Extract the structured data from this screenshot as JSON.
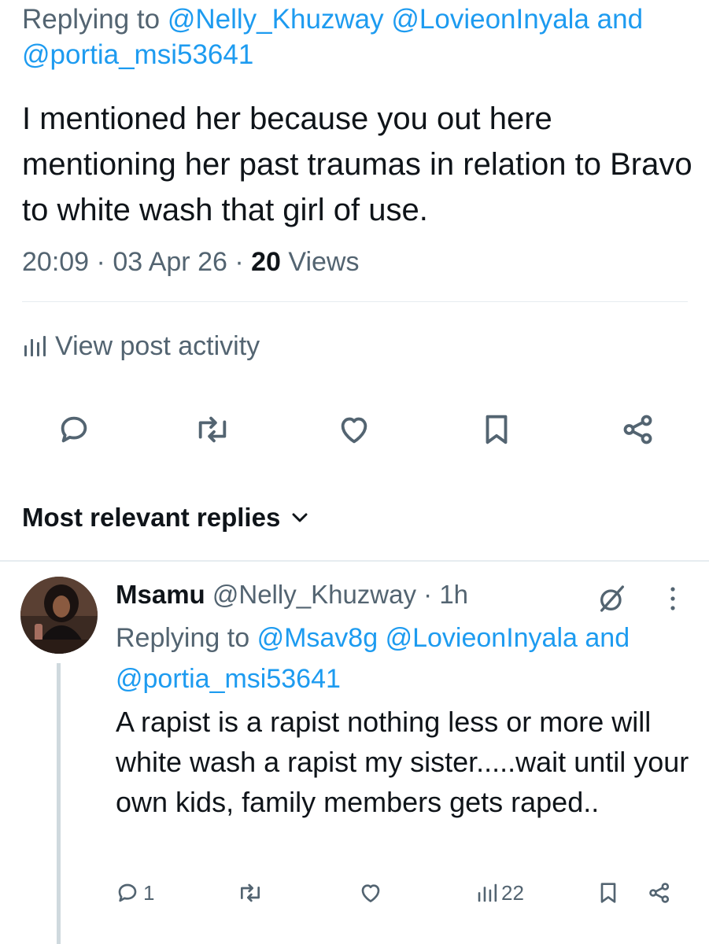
{
  "post": {
    "replying_prefix": "Replying to",
    "replying_handles_line1": "@Nelly_Khuzway @LovieonInyala",
    "replying_and": "and",
    "replying_handle_last": "@portia_msi53641",
    "text": "I mentioned her because you out here mentioning her past traumas in relation to Bravo to white wash that girl of use.",
    "time": "20:09",
    "date": "03 Apr 26",
    "views_count": "20",
    "views_label": "Views",
    "activity_label": "View post activity"
  },
  "actions": {
    "icons": [
      "reply-icon",
      "repost-icon",
      "like-icon",
      "bookmark-icon",
      "share-icon"
    ]
  },
  "replies_sort": {
    "label": "Most relevant replies"
  },
  "reply": {
    "name": "Msamu",
    "handle": "@Nelly_Khuzway",
    "age": "1h",
    "replying_prefix": "Replying to",
    "replying_handles_line1": "@Msav8g @LovieonInyala",
    "replying_and": "and",
    "replying_handle_last": "@portia_msi53641",
    "text": "A rapist is a rapist nothing less or more will white wash a rapist my sister.....wait until your own kids, family members gets raped..",
    "reply_count": "1",
    "views_count": "22"
  },
  "colors": {
    "accent": "#1d9bf0",
    "muted": "#536471",
    "text": "#0f1419"
  }
}
